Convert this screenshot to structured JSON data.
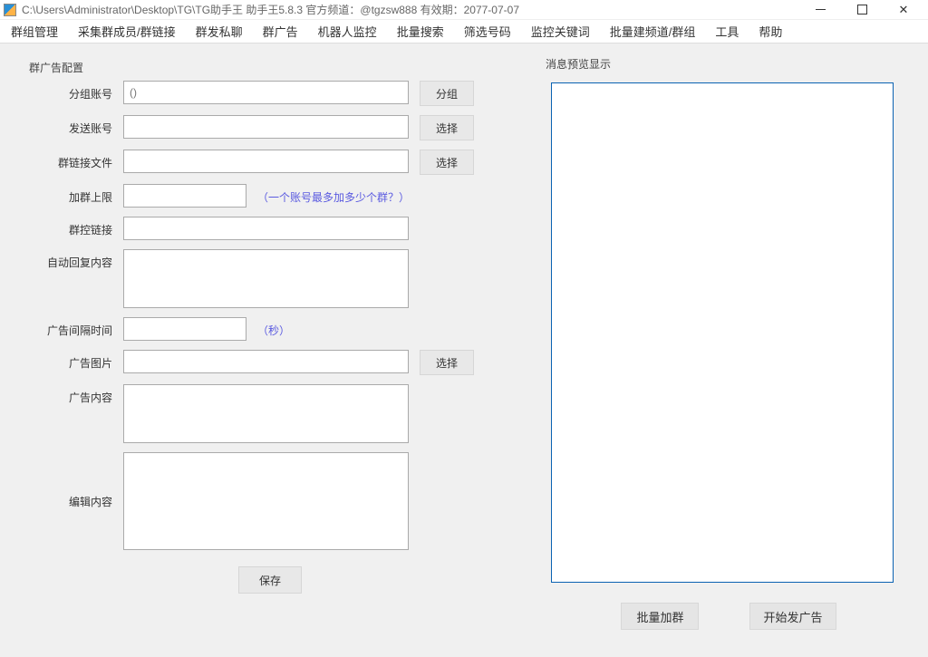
{
  "titlebar": {
    "path": "C:\\Users\\Administrator\\Desktop\\TG\\TG助手王  助手王5.8.3  官方频道：@tgzsw888      有效期：2077-07-07"
  },
  "menu": {
    "group_mgmt": "群组管理",
    "collect_members": "采集群成员/群链接",
    "mass_private": "群发私聊",
    "group_ad": "群广告",
    "bot_monitor": "机器人监控",
    "bulk_search": "批量搜索",
    "filter_numbers": "筛选号码",
    "monitor_keywords": "监控关键词",
    "bulk_create": "批量建频道/群组",
    "tools": "工具",
    "help": "帮助"
  },
  "group_config_title": "群广告配置",
  "labels": {
    "group_account": "分组账号",
    "send_account": "发送账号",
    "group_link_file": "群链接文件",
    "join_limit": "加群上限",
    "group_ctrl_link": "群控链接",
    "auto_reply_content": "自动回复内容",
    "ad_interval": "广告间隔时间",
    "ad_image": "广告图片",
    "ad_content": "广告内容",
    "edit_content": "编辑内容"
  },
  "placeholders": {
    "group_account": "()"
  },
  "hints": {
    "join_limit": "（一个账号最多加多少个群？）",
    "ad_interval": "（秒）"
  },
  "buttons": {
    "group_btn": "分组",
    "select": "选择",
    "save": "保存",
    "bulk_join": "批量加群",
    "start_ad": "开始发广告"
  },
  "preview_title": "消息预览显示",
  "values": {
    "group_account": "",
    "send_account": "",
    "group_link_file": "",
    "join_limit": "",
    "group_ctrl_link": "",
    "auto_reply_content": "",
    "ad_interval": "",
    "ad_image": "",
    "ad_content": "",
    "edit_content": ""
  }
}
